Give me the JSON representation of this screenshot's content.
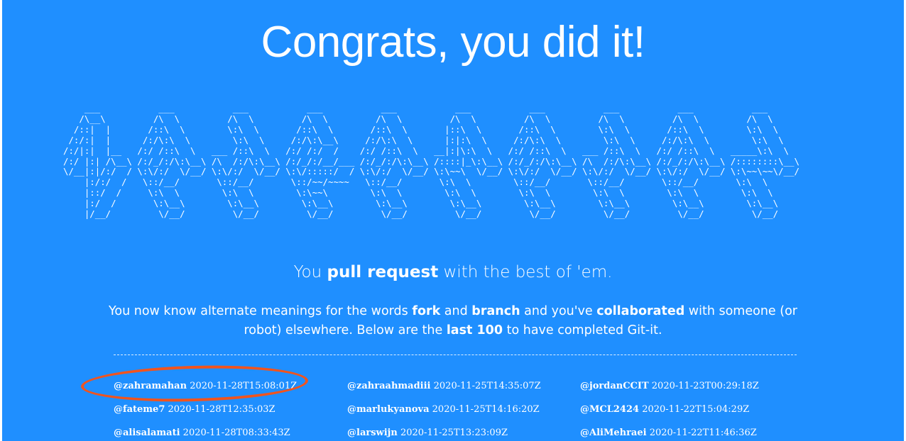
{
  "headline": "Congrats, you did it!",
  "ascii_art": "    ___           ___           ___           ___           ___           ___           ___           ___           ___           ___     \n   /\\__\\         /\\  \\         /\\  \\         /\\  \\         /\\  \\         /\\  \\         /\\  \\         /\\  \\         /\\  \\         /\\  \\    \n  /::|  |       /::\\  \\        \\:\\  \\       /::\\  \\       /::\\  \\       |::\\  \\       /::\\  \\        \\:\\  \\       /::\\  \\        \\:\\  \\   \n /:/:|  |      /:/\\:\\  \\        \\:\\  \\     /:/\\:\\__\\     /:/\\:\\  \\      |:|:\\  \\     /:/\\:\\  \\        \\:\\  \\     /:/\\:\\  \\        \\:\\  \\  \n/:/|:|  |__   /:/ /::\\  \\   ___ /::\\  \\   /:/ /:/  /    /:/ /::\\  \\   __|:|\\:\\  \\   /:/ /::\\  \\   ___ /::\\  \\   /:/ /::\\  \\   _____\\:\\  \\ \n/:/ |:| /\\__\\ /:/_/:/\\:\\__\\ /\\  /:/\\:\\__\\ /:/_/:/__/___ /:/_/:/\\:\\__\\ /::::|_\\:\\__\\ /:/_/:/\\:\\__\\ /\\  /:/\\:\\__\\ /:/_/:/\\:\\__\\ /::::::::\\__\\\n\\/__|:|/:/  / \\:\\/:/  \\/__/ \\:\\/:/  \\/__/ \\:\\/:::::/  / \\:\\/:/  \\/__/ \\:\\~~\\  \\/__/ \\:\\/:/  \\/__/ \\:\\/:/  \\/__/ \\:\\/:/  \\/__/ \\:\\~~\\~~\\/__/\n    |:/:/  /   \\::/__/       \\::/__/       \\::/~~/~~~~   \\::/__/       \\:\\  \\        \\::/__/       \\::/__/       \\::/__/       \\:\\  \\      \n    |::/  /     \\:\\  \\        \\:\\  \\        \\:\\~~\\        \\:\\  \\        \\:\\  \\        \\:\\  \\        \\:\\  \\        \\:\\  \\        \\:\\  \\     \n    |:/  /       \\:\\__\\        \\:\\__\\        \\:\\__\\        \\:\\__\\        \\:\\__\\        \\:\\__\\        \\:\\__\\        \\:\\__\\        \\:\\__\\    \n    |/__/         \\/__/         \\/__/         \\/__/         \\/__/         \\/__/         \\/__/         \\/__/         \\/__/         \\/__/    ",
  "subtitle": {
    "pre": "You ",
    "bold": "pull request",
    "post": " with the best of 'em."
  },
  "blurb": {
    "t1": "You now know alternate meanings for the words ",
    "b1": "fork",
    "t2": " and ",
    "b2": "branch",
    "t3": " and you've ",
    "b3": "collaborated",
    "t4": " with someone (or robot) elsewhere. Below are the ",
    "b4": "last 100",
    "t5": " to have completed Git-it."
  },
  "completers": [
    {
      "user": "@zahramahan",
      "time": "2020-11-28T15:08:01Z"
    },
    {
      "user": "@zahraahmadiii",
      "time": "2020-11-25T14:35:07Z"
    },
    {
      "user": "@jordanCCIT",
      "time": "2020-11-23T00:29:18Z"
    },
    {
      "user": "@fateme7",
      "time": "2020-11-28T12:35:03Z"
    },
    {
      "user": "@marlukyanova",
      "time": "2020-11-25T14:16:20Z"
    },
    {
      "user": "@MCL2424",
      "time": "2020-11-22T15:04:29Z"
    },
    {
      "user": "@alisalamati",
      "time": "2020-11-28T08:33:43Z"
    },
    {
      "user": "@larswijn",
      "time": "2020-11-25T13:23:09Z"
    },
    {
      "user": "@AliMehraei",
      "time": "2020-11-22T11:46:36Z"
    }
  ],
  "colors": {
    "background": "#1f8fff",
    "text": "#ffffff",
    "annotation_ring": "#f0541e"
  }
}
